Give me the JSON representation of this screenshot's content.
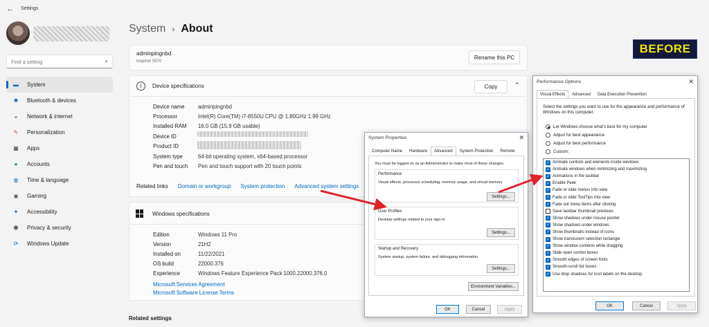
{
  "app_title": "Settings",
  "search": {
    "placeholder": "Find a setting"
  },
  "nav": [
    {
      "label": "System",
      "icon": "monitor-icon",
      "active": true
    },
    {
      "label": "Bluetooth & devices",
      "icon": "bluetooth-icon"
    },
    {
      "label": "Network & internet",
      "icon": "wifi-icon"
    },
    {
      "label": "Personalization",
      "icon": "brush-icon"
    },
    {
      "label": "Apps",
      "icon": "apps-icon"
    },
    {
      "label": "Accounts",
      "icon": "person-icon"
    },
    {
      "label": "Time & language",
      "icon": "globe-icon"
    },
    {
      "label": "Gaming",
      "icon": "controller-icon"
    },
    {
      "label": "Accessibility",
      "icon": "accessibility-icon"
    },
    {
      "label": "Privacy & security",
      "icon": "shield-icon"
    },
    {
      "label": "Windows Update",
      "icon": "update-icon"
    }
  ],
  "breadcrumb": {
    "parent": "System",
    "separator": "›",
    "page": "About"
  },
  "pc": {
    "name": "adminpingnbd",
    "model": "Inspiron 5570",
    "rename_label": "Rename this PC"
  },
  "device_specs": {
    "title": "Device specifications",
    "copy_label": "Copy",
    "rows": [
      {
        "label": "Device name",
        "value": "adminpingnbd"
      },
      {
        "label": "Processor",
        "value": "Intel(R) Core(TM) i7-8550U CPU @ 1.80GHz   1.99 GHz"
      },
      {
        "label": "Installed RAM",
        "value": "16.0 GB (15.9 GB usable)"
      },
      {
        "label": "Device ID",
        "value": ""
      },
      {
        "label": "Product ID",
        "value": ""
      },
      {
        "label": "System type",
        "value": "64-bit operating system, x64-based processor"
      },
      {
        "label": "Pen and touch",
        "value": "Pen and touch support with 20 touch points"
      }
    ]
  },
  "related_links": {
    "label": "Related links",
    "links": [
      "Domain or workgroup",
      "System protection",
      "Advanced system settings"
    ]
  },
  "windows_specs": {
    "title": "Windows specifications",
    "rows": [
      {
        "label": "Edition",
        "value": "Windows 11 Pro"
      },
      {
        "label": "Version",
        "value": "21H2"
      },
      {
        "label": "Installed on",
        "value": "11/22/2021"
      },
      {
        "label": "OS build",
        "value": "22000.376"
      },
      {
        "label": "Experience",
        "value": "Windows Feature Experience Pack 1000.22000.376.0"
      }
    ],
    "links": [
      "Microsoft Services Agreement",
      "Microsoft Software License Terms"
    ]
  },
  "related_settings": "Related settings",
  "badge": "BEFORE",
  "system_properties": {
    "title": "System Properties",
    "tabs": [
      "Computer Name",
      "Hardware",
      "Advanced",
      "System Protection",
      "Remote"
    ],
    "active_tab": "Advanced",
    "admin_note": "You must be logged on as an Administrator to make most of these changes.",
    "groups": [
      {
        "title": "Performance",
        "text": "Visual effects, processor scheduling, memory usage, and virtual memory",
        "button": "Settings..."
      },
      {
        "title": "User Profiles",
        "text": "Desktop settings related to your sign-in",
        "button": "Settings..."
      },
      {
        "title": "Startup and Recovery",
        "text": "System startup, system failure, and debugging information",
        "button": "Settings..."
      }
    ],
    "env_button": "Environment Variables...",
    "ok": "OK",
    "cancel": "Cancel",
    "apply": "Apply"
  },
  "performance_options": {
    "title": "Performance Options",
    "tabs": [
      "Visual Effects",
      "Advanced",
      "Data Execution Prevention"
    ],
    "active_tab": "Visual Effects",
    "intro": "Select the settings you want to use for the appearance and performance of Windows on this computer.",
    "radios": [
      {
        "label": "Let Windows choose what's best for my computer",
        "checked": true
      },
      {
        "label": "Adjust for best appearance",
        "checked": false
      },
      {
        "label": "Adjust for best performance",
        "checked": false
      },
      {
        "label": "Custom:",
        "checked": false
      }
    ],
    "effects": [
      {
        "label": "Animate controls and elements inside windows",
        "checked": true
      },
      {
        "label": "Animate windows when minimizing and maximizing",
        "checked": true
      },
      {
        "label": "Animations in the taskbar",
        "checked": true
      },
      {
        "label": "Enable Peek",
        "checked": true
      },
      {
        "label": "Fade or slide menus into view",
        "checked": true
      },
      {
        "label": "Fade or slide ToolTips into view",
        "checked": true
      },
      {
        "label": "Fade out menu items after clicking",
        "checked": true
      },
      {
        "label": "Save taskbar thumbnail previews",
        "checked": false
      },
      {
        "label": "Show shadows under mouse pointer",
        "checked": true
      },
      {
        "label": "Show shadows under windows",
        "checked": true
      },
      {
        "label": "Show thumbnails instead of icons",
        "checked": true
      },
      {
        "label": "Show translucent selection rectangle",
        "checked": true
      },
      {
        "label": "Show window contents while dragging",
        "checked": true
      },
      {
        "label": "Slide open combo boxes",
        "checked": true
      },
      {
        "label": "Smooth edges of screen fonts",
        "checked": true
      },
      {
        "label": "Smooth-scroll list boxes",
        "checked": true
      },
      {
        "label": "Use drop shadows for icon labels on the desktop",
        "checked": true
      }
    ],
    "ok": "OK",
    "cancel": "Cancel",
    "apply": "Apply"
  },
  "colors": {
    "accent": "#0067c0",
    "arrow": "#e0232b",
    "badge_bg": "#12193b",
    "badge_text": "#f0e20c"
  }
}
